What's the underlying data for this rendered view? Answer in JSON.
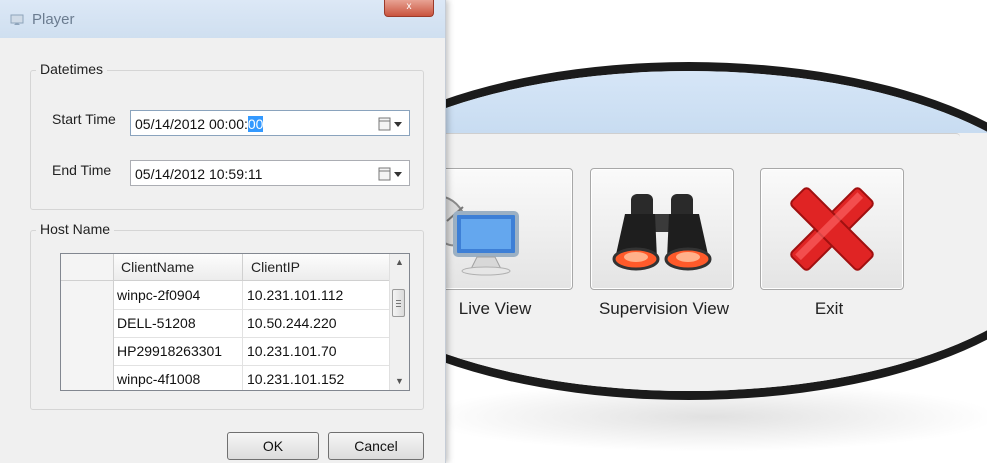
{
  "background_app": {
    "buttons": [
      {
        "label": "Live View",
        "icon": "satellite-monitor-icon"
      },
      {
        "label": "Supervision View",
        "icon": "binoculars-icon"
      },
      {
        "label": "Exit",
        "icon": "red-x-icon"
      }
    ]
  },
  "dialog": {
    "title": "Player",
    "close_glyph": "x",
    "datetimes": {
      "group_label": "Datetimes",
      "start_label": "Start Time",
      "start_value_prefix": "05/14/2012 00:00:",
      "start_value_selected": "00",
      "end_label": "End Time",
      "end_value": "05/14/2012 10:59:11"
    },
    "host": {
      "group_label": "Host Name",
      "columns": [
        "ClientName",
        "ClientIP"
      ],
      "rows": [
        {
          "name": "winpc-2f0904",
          "ip": "10.231.101.112"
        },
        {
          "name": "DELL-51208",
          "ip": "10.50.244.220"
        },
        {
          "name": "HP29918263301",
          "ip": "10.231.101.70"
        },
        {
          "name": "winpc-4f1008",
          "ip": "10.231.101.152"
        }
      ]
    },
    "ok_label": "OK",
    "cancel_label": "Cancel"
  }
}
